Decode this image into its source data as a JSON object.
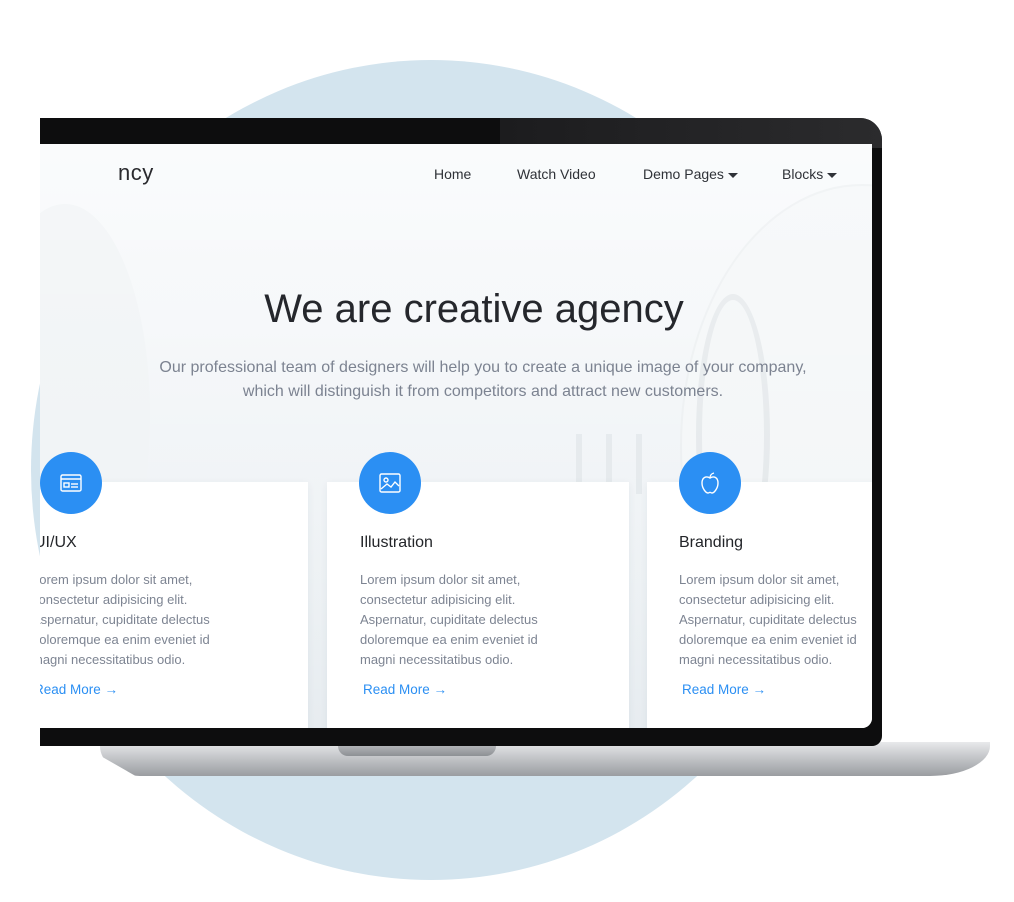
{
  "site": {
    "logo_text": "ncy"
  },
  "nav": {
    "items": [
      {
        "label": "Home"
      },
      {
        "label": "Watch Video"
      },
      {
        "label": "Demo Pages"
      },
      {
        "label": "Blocks"
      }
    ]
  },
  "hero": {
    "title": "We are creative agency",
    "subtitle_line1": "Our professional team of designers will help you to create a unique image of your company,",
    "subtitle_line2": "which will distinguish it from competitors and attract new customers."
  },
  "cards": [
    {
      "icon": "id-card-icon",
      "title": "UI/UX",
      "lines": [
        "Lorem ipsum dolor sit amet,",
        "consectetur adipisicing elit.",
        "Aspernatur, cupiditate delectus",
        "doloremque ea enim eveniet id",
        "magni necessitatibus odio."
      ],
      "link": "Read More →"
    },
    {
      "icon": "image-icon",
      "title": "Illustration",
      "lines": [
        "Lorem ipsum dolor sit amet,",
        "consectetur adipisicing elit.",
        "Aspernatur, cupiditate delectus",
        "doloremque ea enim eveniet id",
        "magni necessitatibus odio."
      ],
      "link": "Read More →"
    },
    {
      "icon": "apple-icon",
      "title": "Branding",
      "lines": [
        "Lorem ipsum dolor sit amet,",
        "consectetur adipisicing elit.",
        "Aspernatur, cupiditate delectus",
        "doloremque ea enim eveniet id",
        "magni necessitatibus odio."
      ],
      "link": "Read More →"
    }
  ],
  "colors": {
    "accent": "#2b8ff3",
    "circle_bg": "#d3e4ee"
  }
}
